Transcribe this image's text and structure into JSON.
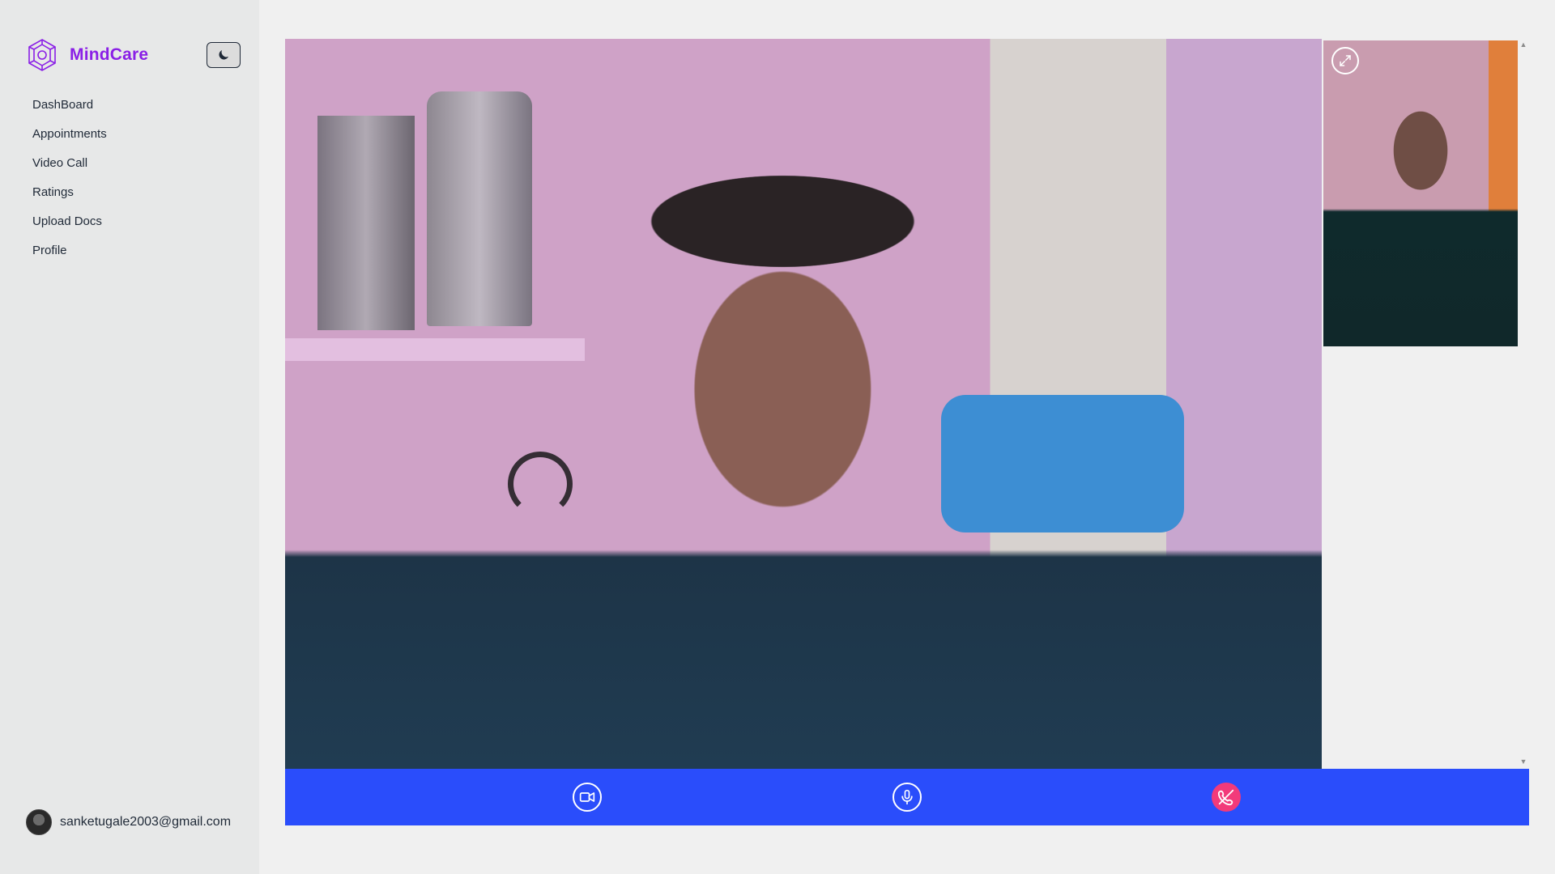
{
  "brand": {
    "name": "MindCare",
    "logo_icon": "hex-flower-logo-icon",
    "color": "#8a1fe6"
  },
  "theme_toggle": {
    "icon": "moon-icon"
  },
  "sidebar": {
    "items": [
      {
        "label": "DashBoard"
      },
      {
        "label": "Appointments"
      },
      {
        "label": "Video Call"
      },
      {
        "label": "Ratings"
      },
      {
        "label": "Upload Docs"
      },
      {
        "label": "Profile"
      }
    ]
  },
  "user": {
    "email": "sanketugale2003@gmail.com"
  },
  "call": {
    "main_video": "remote-video-feed",
    "local_video": "local-video-preview",
    "controls": {
      "bar_color": "#2a4dfb",
      "video": {
        "icon": "video-camera-icon"
      },
      "mic": {
        "icon": "microphone-icon"
      },
      "end": {
        "icon": "phone-hangup-icon",
        "color": "#f23a7a"
      }
    }
  }
}
